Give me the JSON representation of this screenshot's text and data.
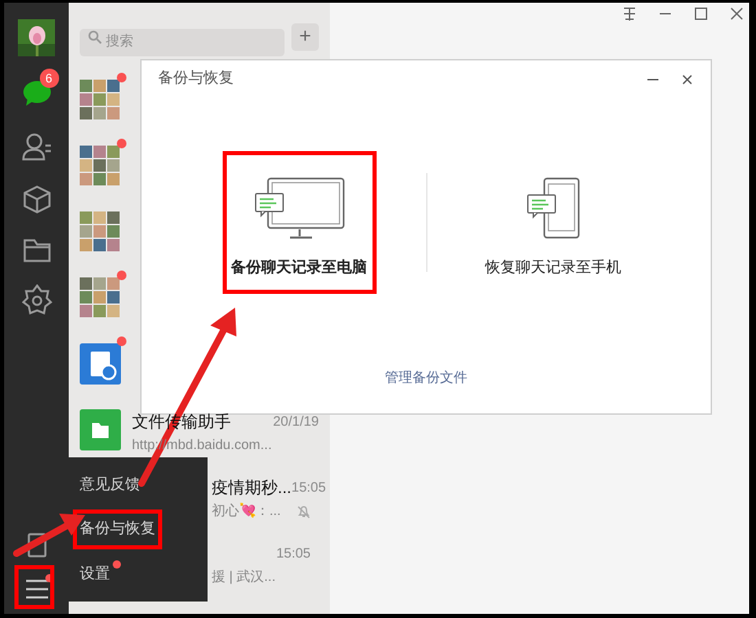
{
  "sidebar": {
    "chat_badge": "6",
    "menu_dot": true
  },
  "search": {
    "placeholder": "搜索",
    "add_button": "+"
  },
  "chats": [
    {
      "kind": "grid",
      "unread": true
    },
    {
      "kind": "grid",
      "unread": true
    },
    {
      "kind": "grid",
      "unread": false
    },
    {
      "kind": "grid",
      "unread": true
    },
    {
      "kind": "doc",
      "unread": true
    },
    {
      "kind": "file",
      "unread": false,
      "title": "文件传输助手",
      "time": "20/1/19",
      "subtitle": "http://mbd.baidu.com..."
    },
    {
      "kind": "covered",
      "unread": false,
      "muted": true,
      "title": "疫情期秒...",
      "time": "15:05",
      "subtitle": "初心💘：..."
    },
    {
      "kind": "covered",
      "unread": false,
      "muted": false,
      "time": "15:05",
      "subtitle": "援 | 武汉..."
    }
  ],
  "dialog": {
    "title": "备份与恢复",
    "options": [
      {
        "kind": "computer",
        "label": "备份聊天记录至电脑",
        "highlighted": true
      },
      {
        "kind": "phone",
        "label": "恢复聊天记录至手机",
        "highlighted": false
      }
    ],
    "link": "管理备份文件"
  },
  "menu": {
    "items": [
      {
        "label": "意见反馈",
        "dot": false,
        "highlighted": false
      },
      {
        "label": "备份与恢复",
        "dot": false,
        "highlighted": true
      },
      {
        "label": "设置",
        "dot": true,
        "highlighted": false
      }
    ]
  }
}
